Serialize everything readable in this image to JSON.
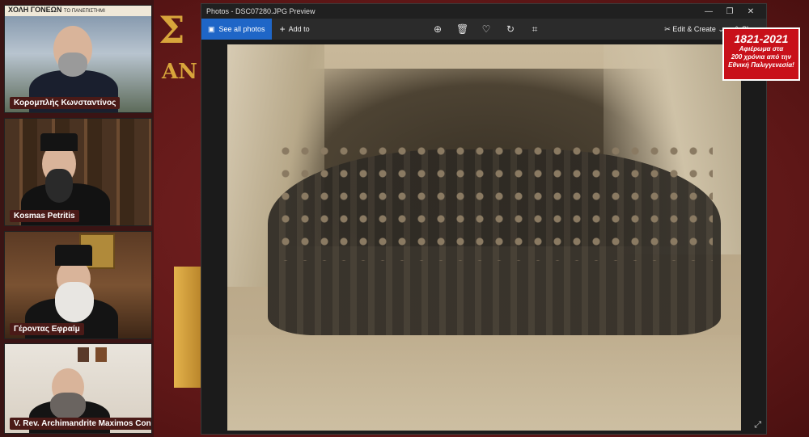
{
  "participants": [
    {
      "name": "Κορομπλής Κωνσταντίνος",
      "banner": "ΧΟΛΗ ΓΟΝΕΩΝ",
      "banner_sub": "ΤΟ ΠΑΝΕΠΙΣΤΗΜΙ"
    },
    {
      "name": "Kosmas Petritis"
    },
    {
      "name": "Γέροντας Εφραίμ"
    },
    {
      "name": "V. Rev. Archimandrite Maximos Cons..."
    }
  ],
  "background": {
    "heading": "Σ",
    "sub": "ΑΝ"
  },
  "window": {
    "title": "Photos - DSC07280.JPG Preview",
    "controls": [
      "—",
      "❐",
      "✕"
    ],
    "see_all": "See all photos",
    "add_to": "Add to",
    "edit_create": "Edit & Create",
    "share": "Share",
    "toolbar_icons": [
      "zoom-icon",
      "delete-icon",
      "heart-icon",
      "rotate-icon",
      "crop-icon"
    ]
  },
  "badge": {
    "years": "1821-2021",
    "line1": "Αφιέρωμα στα",
    "line2": "200 χρόνια από την",
    "line3": "Εθνική Παλιγγενεσία!"
  },
  "colors": {
    "accent": "#1f66c7",
    "badge": "#c8101a",
    "frame": "#6e1f1f"
  }
}
